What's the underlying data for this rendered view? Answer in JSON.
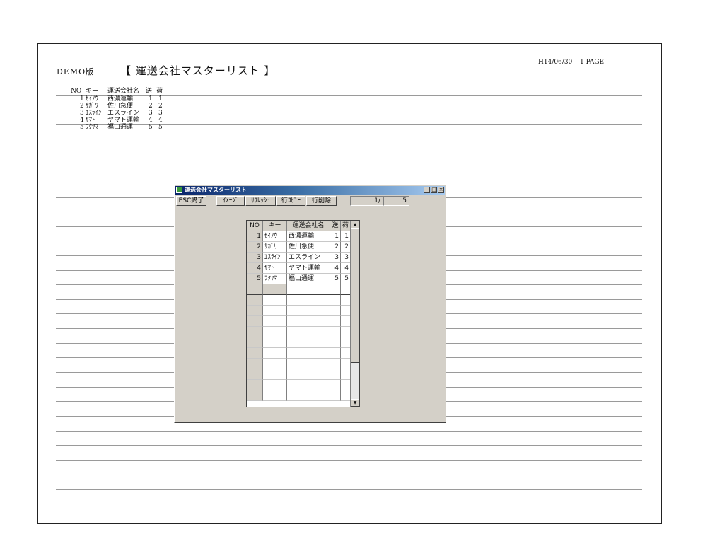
{
  "report": {
    "demo_label": "DEMO版",
    "title": "【 運送会社マスターリスト 】",
    "date": "H14/06/30",
    "page": "1 PAGE",
    "columns": {
      "no": "NO",
      "key": "キー",
      "name": "運送会社名",
      "send": "送",
      "load": "荷"
    },
    "rows": [
      {
        "no": "1",
        "key": "ｾｲﾉｳ",
        "name": "西濃運輸",
        "send": "1",
        "load": "1"
      },
      {
        "no": "2",
        "key": "ｻｶﾞﾜ",
        "name": "佐川急便",
        "send": "2",
        "load": "2"
      },
      {
        "no": "3",
        "key": "ｴｽﾗｲﾝ",
        "name": "エスライン",
        "send": "3",
        "load": "3"
      },
      {
        "no": "4",
        "key": "ﾔﾏﾄ",
        "name": "ヤマト運輸",
        "send": "4",
        "load": "4"
      },
      {
        "no": "5",
        "key": "ﾌｸﾔﾏ",
        "name": "福山通運",
        "send": "5",
        "load": "5"
      }
    ]
  },
  "window": {
    "title": "運送会社マスターリスト",
    "icon": "app-icon",
    "controls": {
      "minimize": "_",
      "maximize": "□",
      "close": "×"
    },
    "toolbar": {
      "esc": "ESC終了",
      "image": "ｲﾒｰｼﾞ",
      "refresh": "ﾘﾌﾚｯｼｭ",
      "copy_row": "行ｺﾋﾟｰ",
      "delete_row": "行削除"
    },
    "pager": {
      "current": "1/",
      "total": "5"
    },
    "grid": {
      "columns": {
        "no": "NO",
        "key": "キー",
        "name": "運送会社名",
        "send": "送",
        "load": "荷"
      },
      "rows": [
        {
          "no": "1",
          "key": "ｾｲﾉｳ",
          "name": "西濃運輸",
          "send": "1",
          "load": "1"
        },
        {
          "no": "2",
          "key": "ｻｶﾞﾘ",
          "name": "佐川急便",
          "send": "2",
          "load": "2"
        },
        {
          "no": "3",
          "key": "ｴｽﾗｲﾝ",
          "name": "エスライン",
          "send": "3",
          "load": "3"
        },
        {
          "no": "4",
          "key": "ﾔﾏﾄ",
          "name": "ヤマト運輸",
          "send": "4",
          "load": "4"
        },
        {
          "no": "5",
          "key": "ﾌｸﾔﾏ",
          "name": "福山通運",
          "send": "5",
          "load": "5"
        }
      ],
      "empty_rows": 11,
      "scroll_up_icon": "▲",
      "scroll_down_icon": "▼"
    }
  }
}
